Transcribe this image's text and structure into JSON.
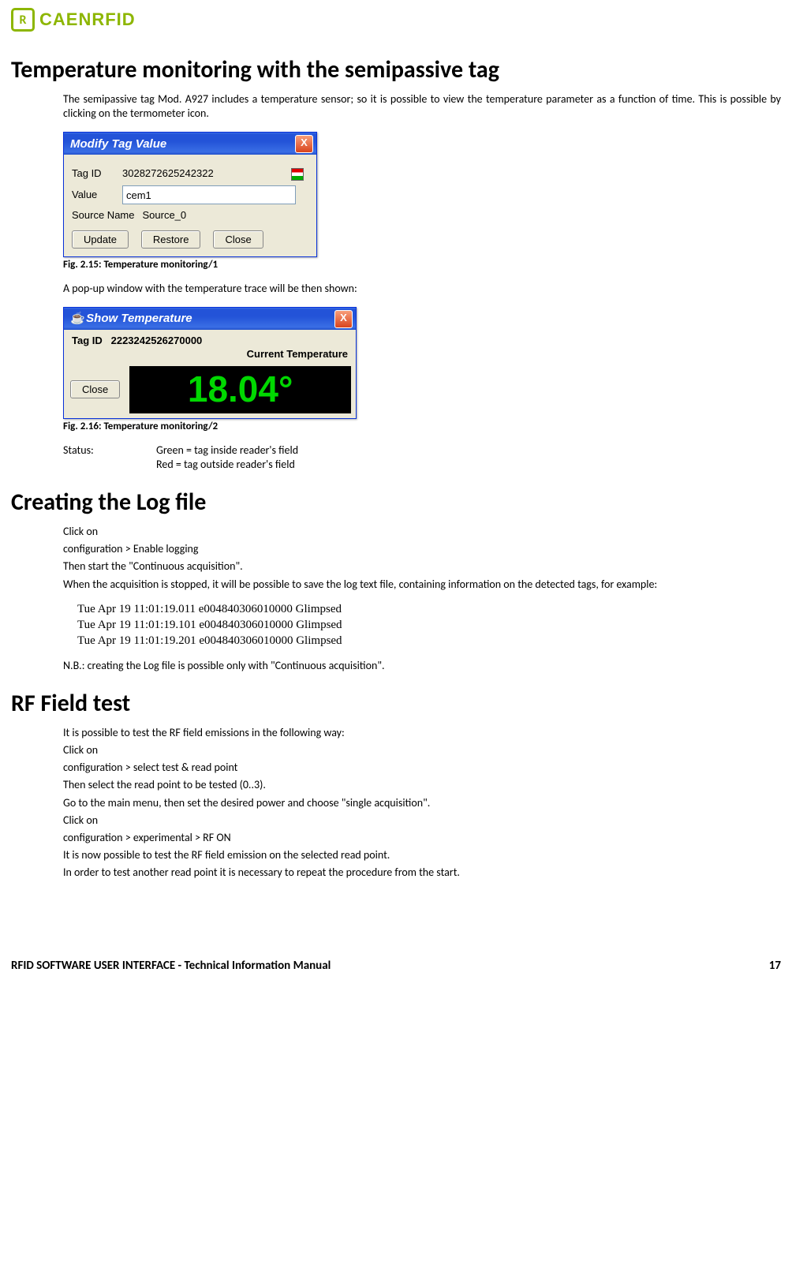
{
  "brand": "CAENRFID",
  "sections": {
    "s1": {
      "title": "Temperature monitoring with the semipassive tag",
      "p1": "The semipassive tag Mod. A927 includes a temperature sensor; so it is possible to view the temperature parameter as a function of time. This is possible by clicking on the termometer icon.",
      "fig1_caption": "Fig. 2.15: Temperature monitoring/1",
      "p2": "A pop-up window with the temperature trace will be then shown:",
      "fig2_caption": "Fig. 2.16: Temperature monitoring/2",
      "status_label": "Status:",
      "status_green": "Green = tag inside reader's field",
      "status_red": "Red = tag outside reader's field"
    },
    "s2": {
      "title": "Creating the Log file",
      "l1": "Click on",
      "l2": "configuration > Enable logging",
      "l3": "Then start the \"Continuous acquisition\".",
      "l4": "When the acquisition is stopped, it will be possible to save the log text file, containing information on the detected tags, for example:",
      "log1": "Tue Apr 19 11:01:19.011  e004840306010000  Glimpsed",
      "log2": "Tue Apr 19 11:01:19.101  e004840306010000  Glimpsed",
      "log3": "Tue Apr 19 11:01:19.201  e004840306010000  Glimpsed",
      "nb": "N.B.: creating the Log file is possible only with \"Continuous acquisition\"."
    },
    "s3": {
      "title": "RF Field test",
      "l1": "It is possible to test the RF field emissions in the following way:",
      "l2": "Click on",
      "l3": "configuration > select test & read point",
      "l4": "Then select the read point to be tested (0..3).",
      "l5": "Go to the main menu, then set the desired power and choose \"single acquisition\".",
      "l6": "Click on",
      "l7": "configuration > experimental > RF ON",
      "l8": "It is now possible to test the RF field emission on the selected read point.",
      "l9": "In order to test another read point it is necessary to repeat the procedure from the start."
    }
  },
  "dialog1": {
    "title": "Modify Tag Value",
    "tagid_label": "Tag ID",
    "tagid_value": "3028272625242322",
    "value_label": "Value",
    "value_input": "cem1",
    "source_label": "Source Name",
    "source_value": "Source_0",
    "btn_update": "Update",
    "btn_restore": "Restore",
    "btn_close": "Close"
  },
  "dialog2": {
    "title": "Show Temperature",
    "tagid_label": "Tag ID",
    "tagid_value": "2223242526270000",
    "current_label": "Current Temperature",
    "temp_value": "18.04°",
    "btn_close": "Close"
  },
  "footer": {
    "left": "RFID SOFTWARE USER INTERFACE -  Technical Information Manual",
    "page": "17"
  }
}
